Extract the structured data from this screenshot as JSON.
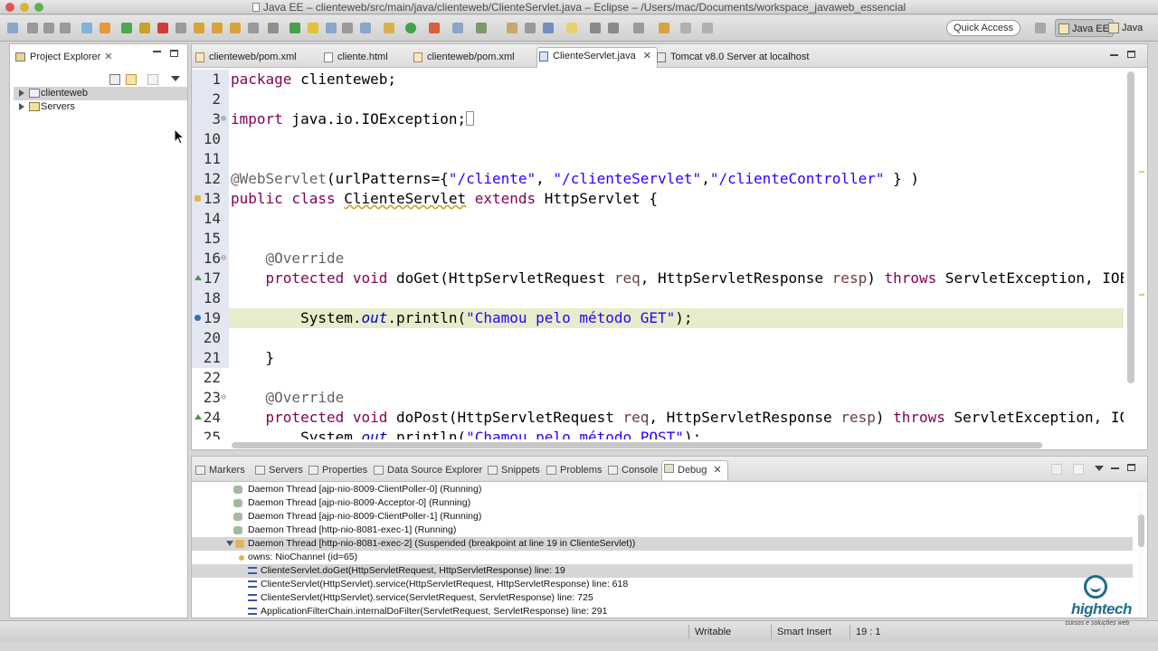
{
  "window": {
    "title": "Java EE – clienteweb/src/main/java/clienteweb/ClienteServlet.java – Eclipse – /Users/mac/Documents/workspace_javaweb_essencial"
  },
  "toolbar": {
    "quick_access": "Quick Access",
    "perspectives": [
      "Java EE",
      "Java"
    ]
  },
  "project_explorer": {
    "title": "Project Explorer",
    "items": [
      {
        "label": "clienteweb",
        "icon": "project-icon"
      },
      {
        "label": "Servers",
        "icon": "folder-icon"
      }
    ]
  },
  "editor": {
    "tabs": [
      {
        "label": "clienteweb/pom.xml",
        "icon": "xml-file-icon"
      },
      {
        "label": "cliente.html",
        "icon": "html-file-icon"
      },
      {
        "label": "clienteweb/pom.xml",
        "icon": "xml-file-icon"
      },
      {
        "label": "ClienteServlet.java",
        "icon": "java-file-icon",
        "active": true
      },
      {
        "label": "Tomcat v8.0 Server at localhost",
        "icon": "server-icon"
      }
    ],
    "lines": [
      {
        "n": "1",
        "code": "package clienteweb;"
      },
      {
        "n": "2",
        "code": ""
      },
      {
        "n": "3",
        "code": "import java.io.IOException;"
      },
      {
        "n": "10",
        "code": ""
      },
      {
        "n": "11",
        "code": ""
      },
      {
        "n": "12",
        "code": "@WebServlet(urlPatterns={\"/cliente\", \"/clienteServlet\",\"/clienteController\" } )"
      },
      {
        "n": "13",
        "code": "public class ClienteServlet extends HttpServlet {"
      },
      {
        "n": "14",
        "code": ""
      },
      {
        "n": "15",
        "code": ""
      },
      {
        "n": "16",
        "code": "    @Override"
      },
      {
        "n": "17",
        "code": "    protected void doGet(HttpServletRequest req, HttpServletResponse resp) throws ServletException, IOExc"
      },
      {
        "n": "18",
        "code": ""
      },
      {
        "n": "19",
        "code": "        System.out.println(\"Chamou pelo método GET\");"
      },
      {
        "n": "20",
        "code": ""
      },
      {
        "n": "21",
        "code": "    }"
      },
      {
        "n": "22",
        "code": ""
      },
      {
        "n": "23",
        "code": "    @Override"
      },
      {
        "n": "24",
        "code": "    protected void doPost(HttpServletRequest req, HttpServletResponse resp) throws ServletException, IOE:"
      },
      {
        "n": "25",
        "code": "        System.out.println(\"Chamou pelo método POST\");"
      }
    ]
  },
  "bottom_panel": {
    "tabs": [
      "Markers",
      "Servers",
      "Properties",
      "Data Source Explorer",
      "Snippets",
      "Problems",
      "Console",
      "Debug"
    ],
    "active_tab": "Debug",
    "rows": [
      {
        "text": "Daemon Thread [ajp-nio-8009-ClientPoller-0] (Running)"
      },
      {
        "text": "Daemon Thread [ajp-nio-8009-Acceptor-0] (Running)"
      },
      {
        "text": "Daemon Thread [ajp-nio-8009-ClientPoller-1] (Running)"
      },
      {
        "text": "Daemon Thread [http-nio-8081-exec-1] (Running)"
      },
      {
        "text": "Daemon Thread [http-nio-8081-exec-2] (Suspended (breakpoint at line 19 in ClienteServlet))"
      },
      {
        "text": "owns: NioChannel  (id=65)"
      },
      {
        "text": "ClienteServlet.doGet(HttpServletRequest, HttpServletResponse) line: 19"
      },
      {
        "text": "ClienteServlet(HttpServlet).service(HttpServletRequest, HttpServletResponse) line: 618"
      },
      {
        "text": "ClienteServlet(HttpServlet).service(ServletRequest, ServletResponse) line: 725"
      },
      {
        "text": "ApplicationFilterChain.internalDoFilter(ServletRequest, ServletResponse) line: 291"
      }
    ]
  },
  "status_bar": {
    "writable": "Writable",
    "insert_mode": "Smart Insert",
    "position": "19 : 1"
  },
  "logo": {
    "name": "hightech",
    "tagline": "cursos e soluções web"
  }
}
